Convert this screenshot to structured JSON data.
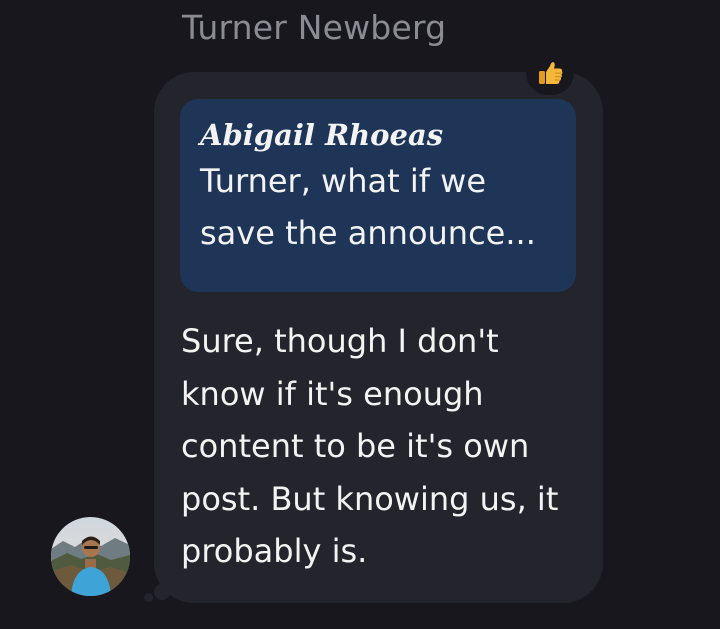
{
  "message": {
    "sender_name": "Turner Newberg",
    "reply": {
      "author": "Abigail Rhoeas",
      "text": "Turner, what if we save the announce..."
    },
    "body": "Sure, though I don't know if it's enough content to be it's own post. But knowing us, it probably is.",
    "reaction": {
      "icon": "thumbs-up-icon",
      "color": "#f4b63b"
    }
  },
  "colors": {
    "background": "#17171d",
    "bubble": "#24242c",
    "reply_quote": "#1e3558",
    "text": "#f3f3f3",
    "sender_name": "#8b8b94"
  }
}
